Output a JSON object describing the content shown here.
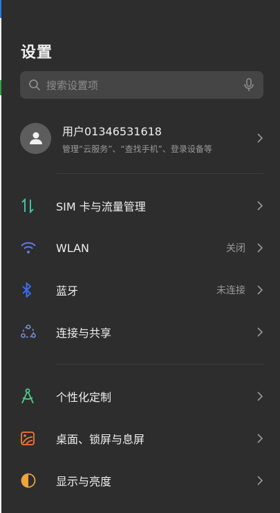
{
  "header": {
    "title": "设置"
  },
  "search": {
    "placeholder": "搜索设置项"
  },
  "account": {
    "name": "用户01346531618",
    "subtitle": "管理“云服务”、“查找手机”、登录设备等"
  },
  "items": [
    {
      "label": "SIM 卡与流量管理",
      "status": "",
      "icon": "sim-data-icon",
      "color": "#3fc2a0"
    },
    {
      "label": "WLAN",
      "status": "关闭",
      "icon": "wifi-icon",
      "color": "#5b7cf0"
    },
    {
      "label": "蓝牙",
      "status": "未连接",
      "icon": "bluetooth-icon",
      "color": "#3d6cf2"
    },
    {
      "label": "连接与共享",
      "status": "",
      "icon": "share-icon",
      "color": "#7b8fd8"
    },
    {
      "label": "个性化定制",
      "status": "",
      "icon": "personalize-icon",
      "color": "#4fd08a"
    },
    {
      "label": "桌面、锁屏与息屏",
      "status": "",
      "icon": "wallpaper-icon",
      "color": "#f07a3c"
    },
    {
      "label": "显示与亮度",
      "status": "",
      "icon": "display-icon",
      "color": "#f0a23c"
    }
  ]
}
